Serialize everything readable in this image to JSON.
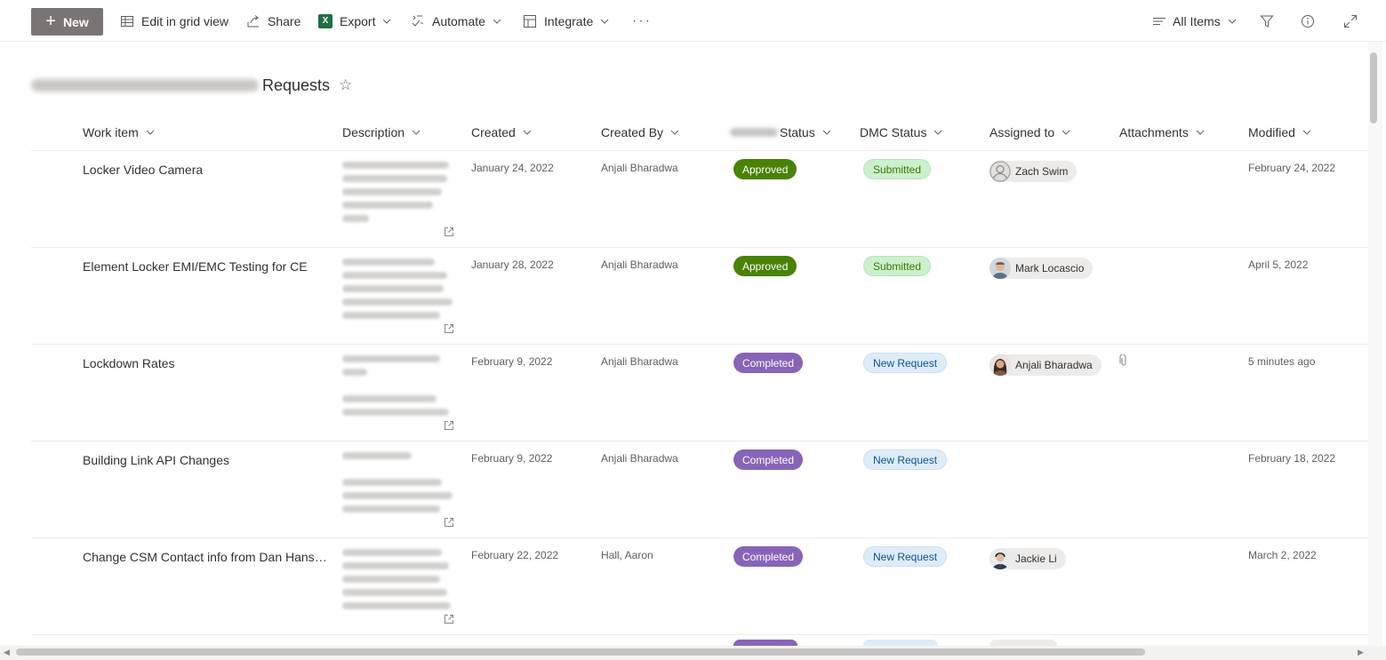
{
  "command_bar": {
    "new_label": "New",
    "edit_grid_label": "Edit in grid view",
    "share_label": "Share",
    "export_label": "Export",
    "automate_label": "Automate",
    "integrate_label": "Integrate",
    "more_label": "···",
    "view_label": "All Items"
  },
  "list": {
    "title_suffix": "Requests",
    "star": "☆"
  },
  "columns": {
    "work_item": "Work item",
    "description": "Description",
    "created": "Created",
    "created_by": "Created By",
    "status": "Status",
    "dmc_status": "DMC Status",
    "assigned_to": "Assigned to",
    "attachments": "Attachments",
    "modified": "Modified"
  },
  "rows": [
    {
      "work_item": "Locker Video Camera",
      "created": "January 24, 2022",
      "created_by": "Anjali Bharadwa",
      "status": "Approved",
      "dmc_status": "Submitted",
      "assigned_to": "Zach Swim",
      "modified": "February 24, 2022"
    },
    {
      "work_item": "Element Locker EMI/EMC Testing for CE",
      "created": "January 28, 2022",
      "created_by": "Anjali Bharadwa",
      "status": "Approved",
      "dmc_status": "Submitted",
      "assigned_to": "Mark Locascio",
      "modified": "April 5, 2022"
    },
    {
      "work_item": "Lockdown Rates",
      "created": "February 9, 2022",
      "created_by": "Anjali Bharadwa",
      "status": "Completed",
      "dmc_status": "New Request",
      "assigned_to": "Anjali Bharadwa",
      "modified": "5 minutes ago"
    },
    {
      "work_item": "Building Link API Changes",
      "created": "February 9, 2022",
      "created_by": "Anjali Bharadwa",
      "status": "Completed",
      "dmc_status": "New Request",
      "assigned_to": "",
      "modified": "February 18, 2022"
    },
    {
      "work_item": "Change CSM Contact info from Dan Hanso...",
      "created": "February 22, 2022",
      "created_by": "Hall, Aaron",
      "status": "Completed",
      "dmc_status": "New Request",
      "assigned_to": "Jackie Li",
      "modified": "March 2, 2022"
    }
  ],
  "colors": {
    "approved": "#498205",
    "completed": "#8764b8",
    "submitted_bg": "#caf0cc",
    "new_request_bg": "#deecf9",
    "new_button": "#7a7574"
  },
  "icons": {
    "grid": "grid-icon",
    "share": "share-icon",
    "excel": "excel-icon",
    "automate": "automate-icon",
    "integrate": "integrate-icon",
    "filter": "filter-icon",
    "info": "info-icon",
    "expand": "expand-icon",
    "open_item": "open-external-icon",
    "attachment": "paperclip-icon",
    "favorite": "star-icon"
  }
}
